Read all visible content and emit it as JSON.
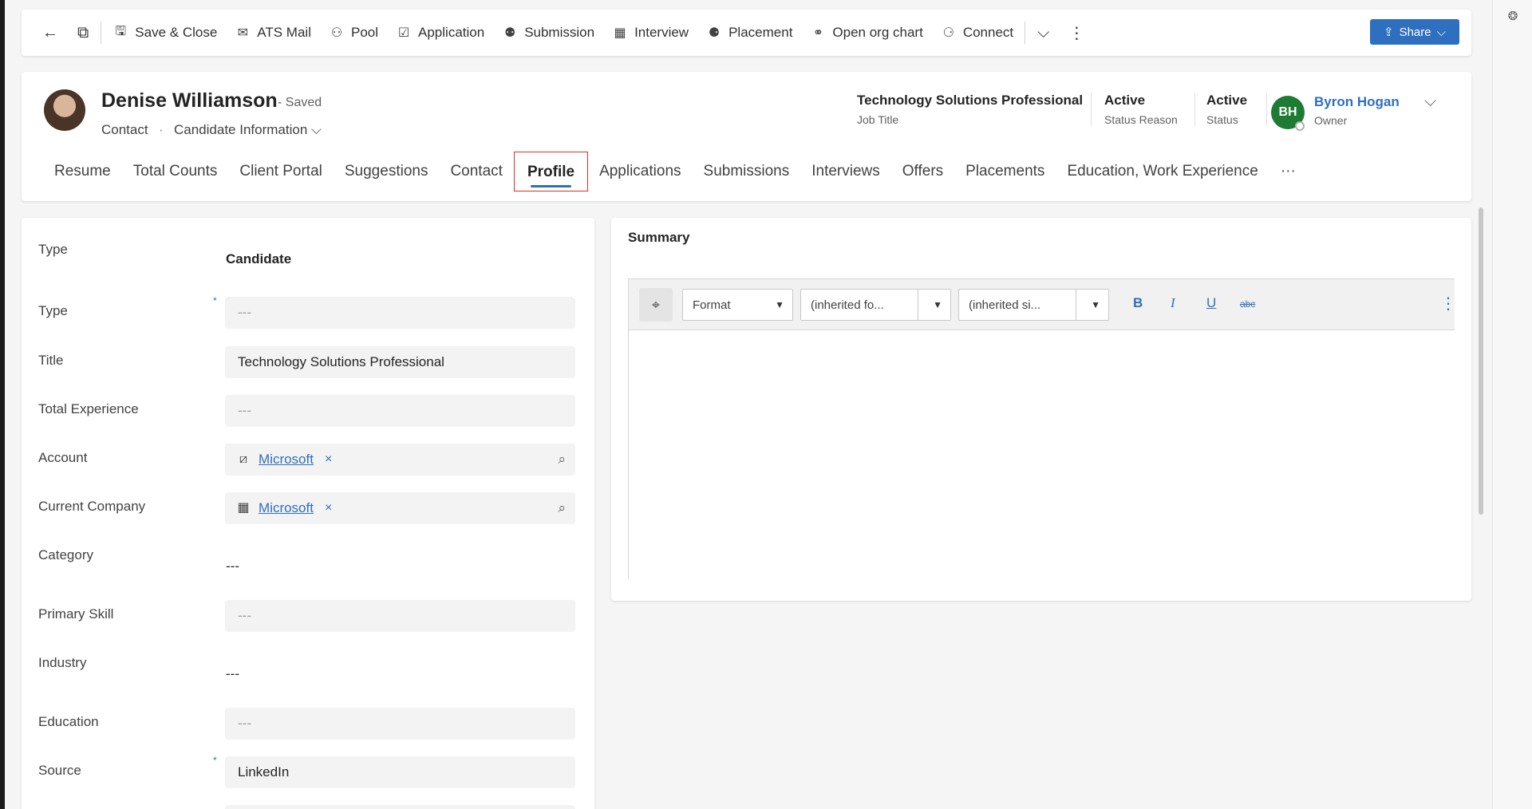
{
  "commands": {
    "back": "←",
    "popout": "⧉",
    "save_close": "Save & Close",
    "ats_mail": "ATS Mail",
    "pool": "Pool",
    "application": "Application",
    "submission": "Submission",
    "interview": "Interview",
    "placement": "Placement",
    "open_org_chart": "Open org chart",
    "connect": "Connect",
    "more_chevron": "⌵",
    "overflow": "⋮",
    "share": "Share"
  },
  "record": {
    "name": "Denise Williamson",
    "saved": "- Saved",
    "entity": "Contact",
    "separator": "·",
    "form": "Candidate Information ⌵"
  },
  "header_fields": {
    "job_title_value": "Technology Solutions Professional",
    "job_title_label": "Job Title",
    "status_reason_value": "Active",
    "status_reason_label": "Status Reason",
    "status_value": "Active",
    "status_label": "Status",
    "owner_initials": "BH",
    "owner_name": "Byron Hogan",
    "owner_label": "Owner"
  },
  "tabs": [
    "Resume",
    "Total Counts",
    "Client Portal",
    "Suggestions",
    "Contact",
    "Profile",
    "Applications",
    "Submissions",
    "Interviews",
    "Offers",
    "Placements",
    "Education, Work Experience",
    "···"
  ],
  "active_tab": "Profile",
  "form": {
    "type1_label": "Type",
    "type1_value": "Candidate",
    "type2_label": "Type",
    "type2_value": "---",
    "title_label": "Title",
    "title_value": "Technology Solutions Professional",
    "total_exp_label": "Total Experience",
    "total_exp_value": "---",
    "account_label": "Account",
    "account_value": "Microsoft",
    "current_company_label": "Current Company",
    "current_company_value": "Microsoft",
    "category_label": "Category",
    "category_value": "---",
    "primary_skill_label": "Primary Skill",
    "primary_skill_value": "---",
    "industry_label": "Industry",
    "industry_value": "---",
    "education_label": "Education",
    "education_value": "---",
    "source_label": "Source",
    "source_value": "LinkedIn",
    "required_marker": "*",
    "remove_glyph": "×"
  },
  "summary": {
    "title": "Summary",
    "format": "Format",
    "font": "(inherited fo...",
    "size": "(inherited si...",
    "bold": "B",
    "italic": "I",
    "underline": "U",
    "strike": "abc",
    "more": "⋮"
  },
  "colors": {
    "accent": "#2f6fbf",
    "owner_avatar": "#1e7b34",
    "active_tab_outline": "#d93025"
  }
}
